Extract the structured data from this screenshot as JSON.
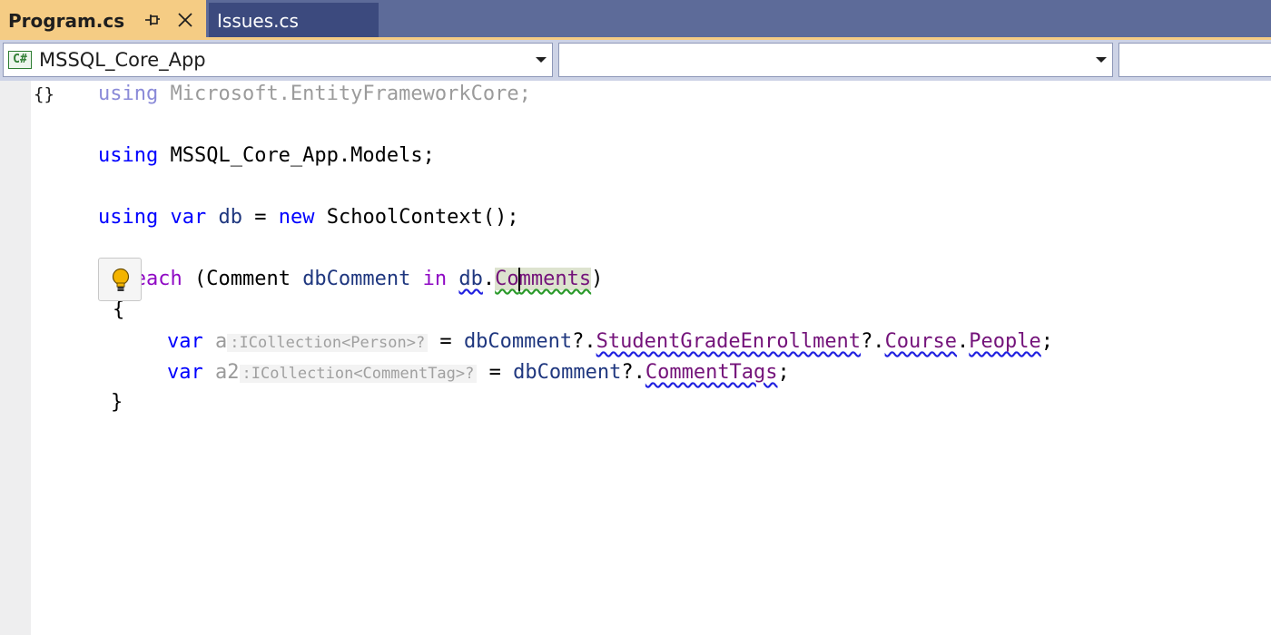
{
  "tabs": {
    "active_label": "Program.cs",
    "inactive_label": "Issues.cs"
  },
  "navbar": {
    "project_label": "MSSQL_Core_App",
    "project_icon_text": "C#",
    "type_label": "",
    "member_label": ""
  },
  "code": {
    "line1": {
      "kw": "using",
      "ns": " Microsoft.EntityFrameworkCore;"
    },
    "line2": {
      "kw": "using",
      "ns": " MSSQL_Core_App.Models;"
    },
    "line3": {
      "kw1": "using",
      "kw2": "var",
      "var": "db",
      "eq": " = ",
      "kw3": "new",
      "type": "SchoolContext",
      "end": "();"
    },
    "line4": {
      "kw": "foreach",
      "open": " (",
      "type": "Comment",
      "var": "dbComment",
      "kw_in": "in",
      "obj": "db",
      "dot": ".",
      "member_a": "Co",
      "member_b": "mments",
      "close": ")"
    },
    "line5": {
      "brace": "{"
    },
    "line6": {
      "kw": "var",
      "var": "a",
      "hint": ":ICollection<Person>?",
      "eq": " = ",
      "obj": "dbComment",
      "op1": "?.",
      "m1": "StudentGradeEnrollment",
      "op2": "?.",
      "m2": "Course",
      "op3": ".",
      "m3": "People",
      "end": ";"
    },
    "line7": {
      "kw": "var",
      "var": "a2",
      "hint": ":ICollection<CommentTag>?",
      "eq": " = ",
      "obj": "dbComment",
      "op1": "?.",
      "m1": "CommentTags",
      "end": ";"
    },
    "line8": {
      "brace": "}"
    }
  },
  "icons": {
    "pin": "pin-icon",
    "close": "close-icon",
    "namespace": "namespace-icon",
    "lightbulb": "lightbulb-icon",
    "project": "csharp-project-icon"
  },
  "colors": {
    "tab_active": "#f5cc84",
    "tab_strip": "#5d6b99",
    "tab_inactive": "#3c4a7e",
    "keyword": "#0000ff",
    "control_keyword": "#8f08c4",
    "member": "#74137a",
    "local": "#1f377f"
  },
  "namespace_glyph": "{}"
}
